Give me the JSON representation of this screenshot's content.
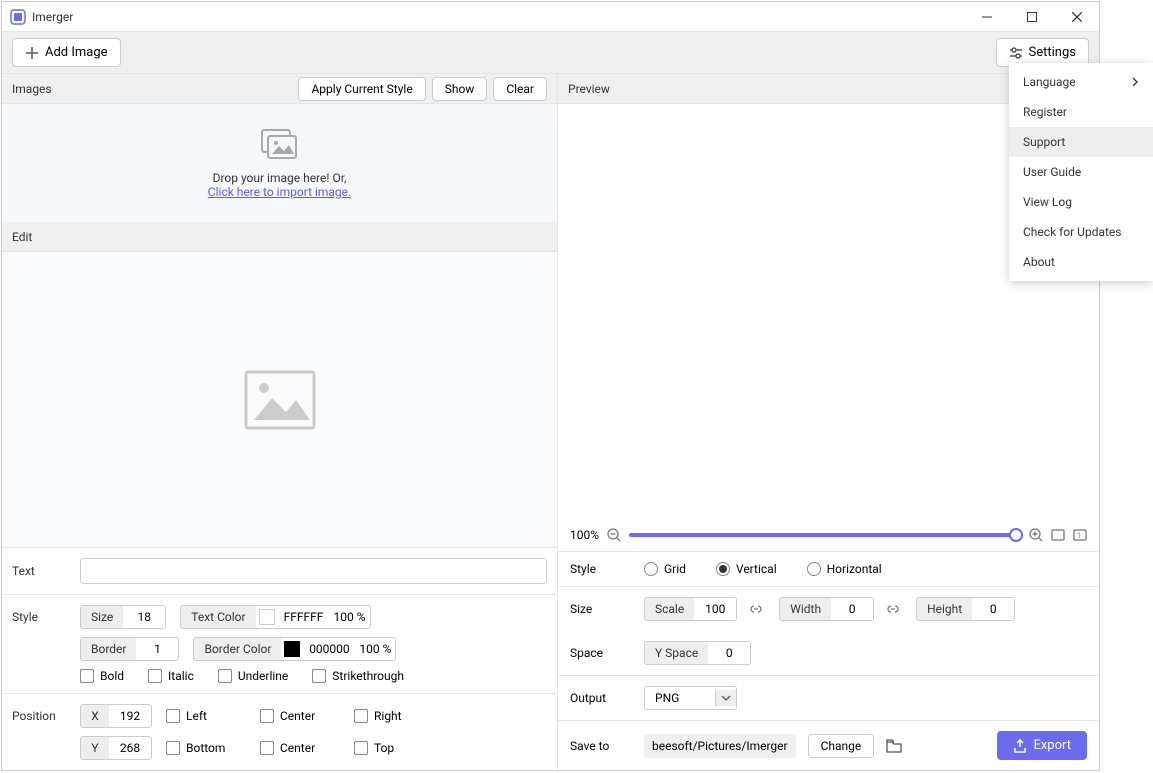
{
  "app": {
    "title": "Imerger"
  },
  "toolbar": {
    "add_image": "Add Image",
    "settings": "Settings"
  },
  "settings_menu": {
    "language": "Language",
    "register": "Register",
    "support": "Support",
    "user_guide": "User Guide",
    "view_log": "View Log",
    "check_updates": "Check for Updates",
    "about": "About"
  },
  "images_panel": {
    "title": "Images",
    "apply_style": "Apply Current Style",
    "show": "Show",
    "clear": "Clear",
    "drop_text": "Drop your image here! Or,",
    "import_link": "Click here to import image."
  },
  "edit_panel": {
    "title": "Edit"
  },
  "text_section": {
    "label": "Text",
    "value": ""
  },
  "style_section": {
    "label": "Style",
    "size_label": "Size",
    "size_value": "18",
    "text_color_label": "Text Color",
    "text_color_hex": "FFFFFF",
    "text_color_pct": "100 %",
    "text_color_swatch": "#ffffff",
    "border_label": "Border",
    "border_value": "1",
    "border_color_label": "Border Color",
    "border_color_hex": "000000",
    "border_color_pct": "100 %",
    "border_color_swatch": "#000000",
    "bold": "Bold",
    "italic": "Italic",
    "underline": "Underline",
    "strikethrough": "Strikethrough"
  },
  "position_section": {
    "label": "Position",
    "x_label": "X",
    "x_value": "192",
    "y_label": "Y",
    "y_value": "268",
    "left": "Left",
    "center": "Center",
    "right": "Right",
    "bottom": "Bottom",
    "top": "Top"
  },
  "preview_panel": {
    "title": "Preview"
  },
  "zoom": {
    "value": "100%"
  },
  "layout": {
    "style_label": "Style",
    "grid": "Grid",
    "vertical": "Vertical",
    "horizontal": "Horizontal",
    "size_label": "Size",
    "scale_label": "Scale",
    "scale_value": "100",
    "width_label": "Width",
    "width_value": "0",
    "height_label": "Height",
    "height_value": "0",
    "space_label": "Space",
    "yspace_label": "Y Space",
    "yspace_value": "0"
  },
  "output": {
    "label": "Output",
    "format": "PNG",
    "saveto_label": "Save to",
    "path": "beesoft/Pictures/Imerger",
    "change": "Change",
    "export": "Export"
  }
}
